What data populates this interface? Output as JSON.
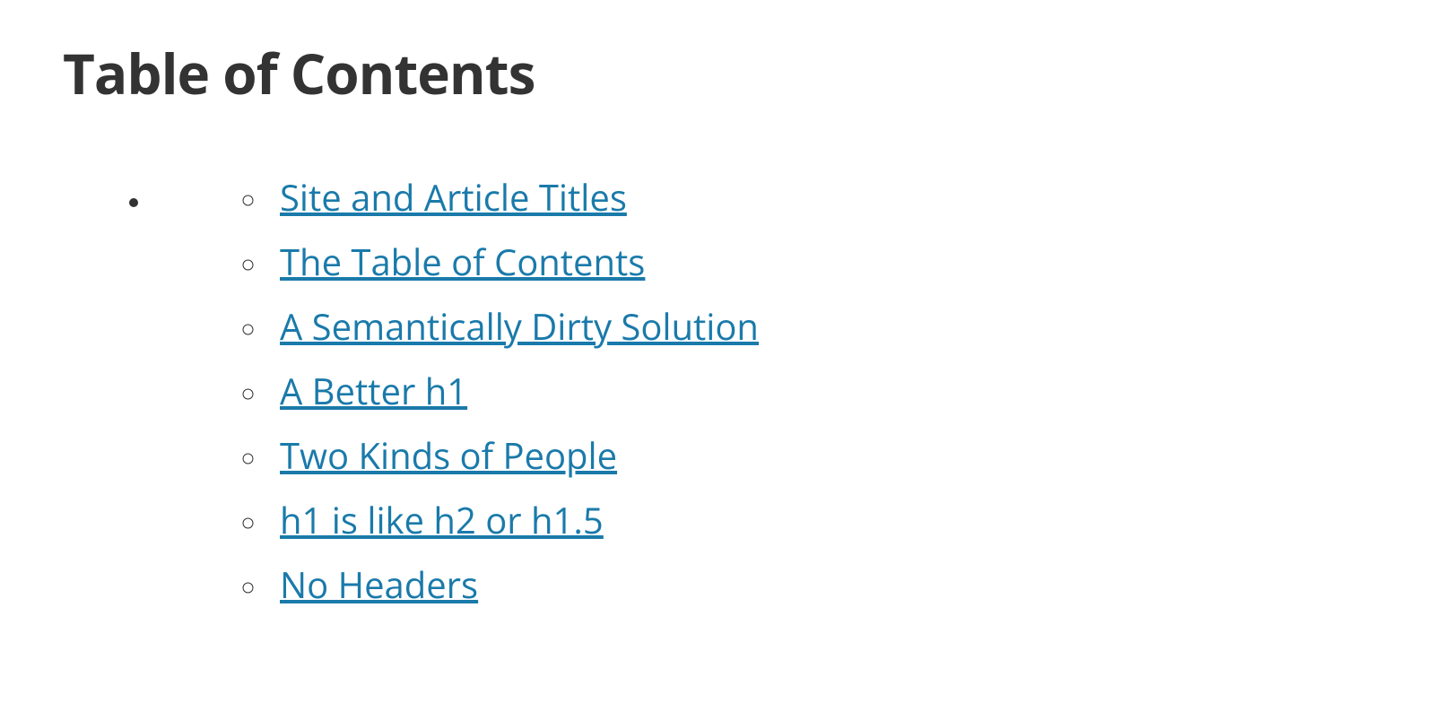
{
  "toc": {
    "title": "Table of Contents",
    "items": [
      "Site and Article Titles",
      "The Table of Contents",
      "A Semantically Dirty Solution",
      "A Better h1",
      "Two Kinds of People",
      "h1 is like h2 or h1.5",
      "No Headers"
    ]
  },
  "colors": {
    "link": "#1a7aaa",
    "text": "#333333",
    "background": "#ffffff"
  }
}
